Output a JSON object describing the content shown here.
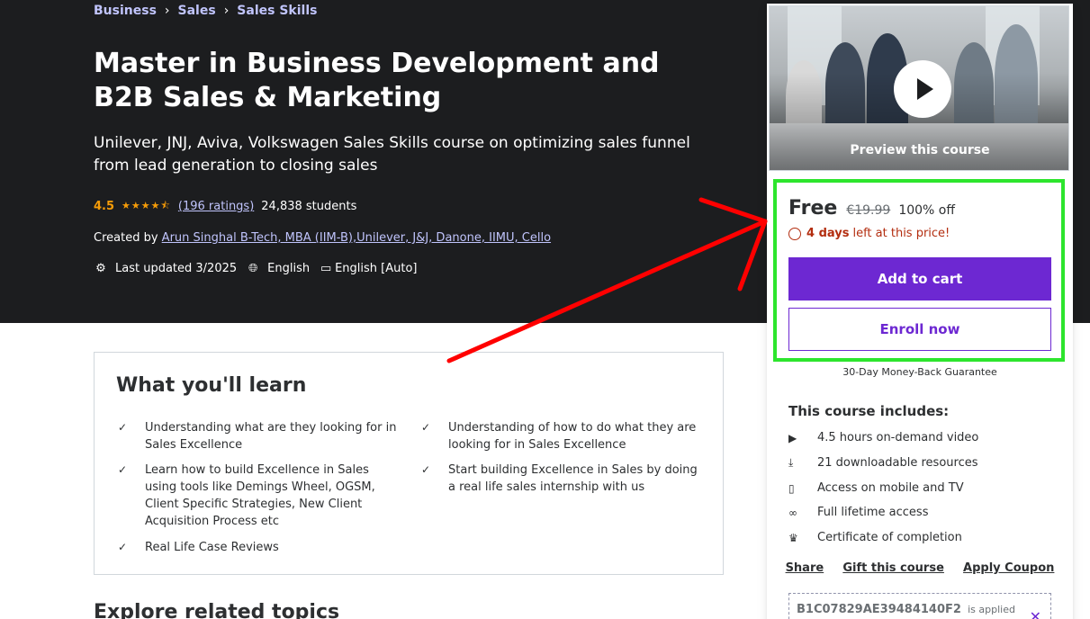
{
  "breadcrumb": [
    "Business",
    "Sales",
    "Sales Skills"
  ],
  "course": {
    "title": "Master in Business Development and B2B Sales & Marketing",
    "subtitle": "Unilever, JNJ, Aviva, Volkswagen Sales Skills course on optimizing sales funnel from lead generation to closing sales",
    "rating": "4.5",
    "rating_stars": 4.5,
    "ratings_count": "(196 ratings)",
    "students": "24,838 students",
    "created_by_label": "Created by",
    "instructor": "Arun Singhal B-Tech, MBA (IIM-B),Unilever, J&J, Danone, IIMU, Cello",
    "last_updated": "Last updated 3/2025",
    "language": "English",
    "captions": "English [Auto]"
  },
  "learn": {
    "title": "What you'll learn",
    "items": [
      "Understanding what are they looking for in Sales Excellence",
      "Understanding of how to do what they are looking for in Sales Excellence",
      "Learn how to build Excellence in Sales using tools like Demings Wheel, OGSM, Client Specific Strategies, New Client Acquisition Process etc",
      "Start building Excellence in Sales by doing a real life sales internship with us",
      "Real Life Case Reviews"
    ]
  },
  "explore_title": "Explore related topics",
  "sidebar": {
    "preview_label": "Preview this course",
    "price": "Free",
    "original_price": "€19.99",
    "discount": "100% off",
    "time_left_bold": "4 days",
    "time_left_rest": "left at this price!",
    "add_to_cart": "Add to cart",
    "enroll_now": "Enroll now",
    "guarantee": "30-Day Money-Back Guarantee",
    "includes_title": "This course includes:",
    "includes": [
      {
        "icon": "video-icon",
        "label": "4.5 hours on-demand video"
      },
      {
        "icon": "download-icon",
        "label": "21 downloadable resources"
      },
      {
        "icon": "mobile-icon",
        "label": "Access on mobile and TV"
      },
      {
        "icon": "infinity-icon",
        "label": "Full lifetime access"
      },
      {
        "icon": "trophy-icon",
        "label": "Certificate of completion"
      }
    ],
    "links": [
      "Share",
      "Gift this course",
      "Apply Coupon"
    ],
    "coupon_code": "B1C07829AE39484140F2",
    "coupon_status": "is applied"
  },
  "colors": {
    "hero_bg": "#1c1d1f",
    "accent_purple": "#6d28d2",
    "link_lavender": "#c0c4fc",
    "star_orange": "#f69c08",
    "timer_red": "#b32d0f",
    "annotation_red": "#ff0000",
    "annotation_green": "#2de52d"
  }
}
